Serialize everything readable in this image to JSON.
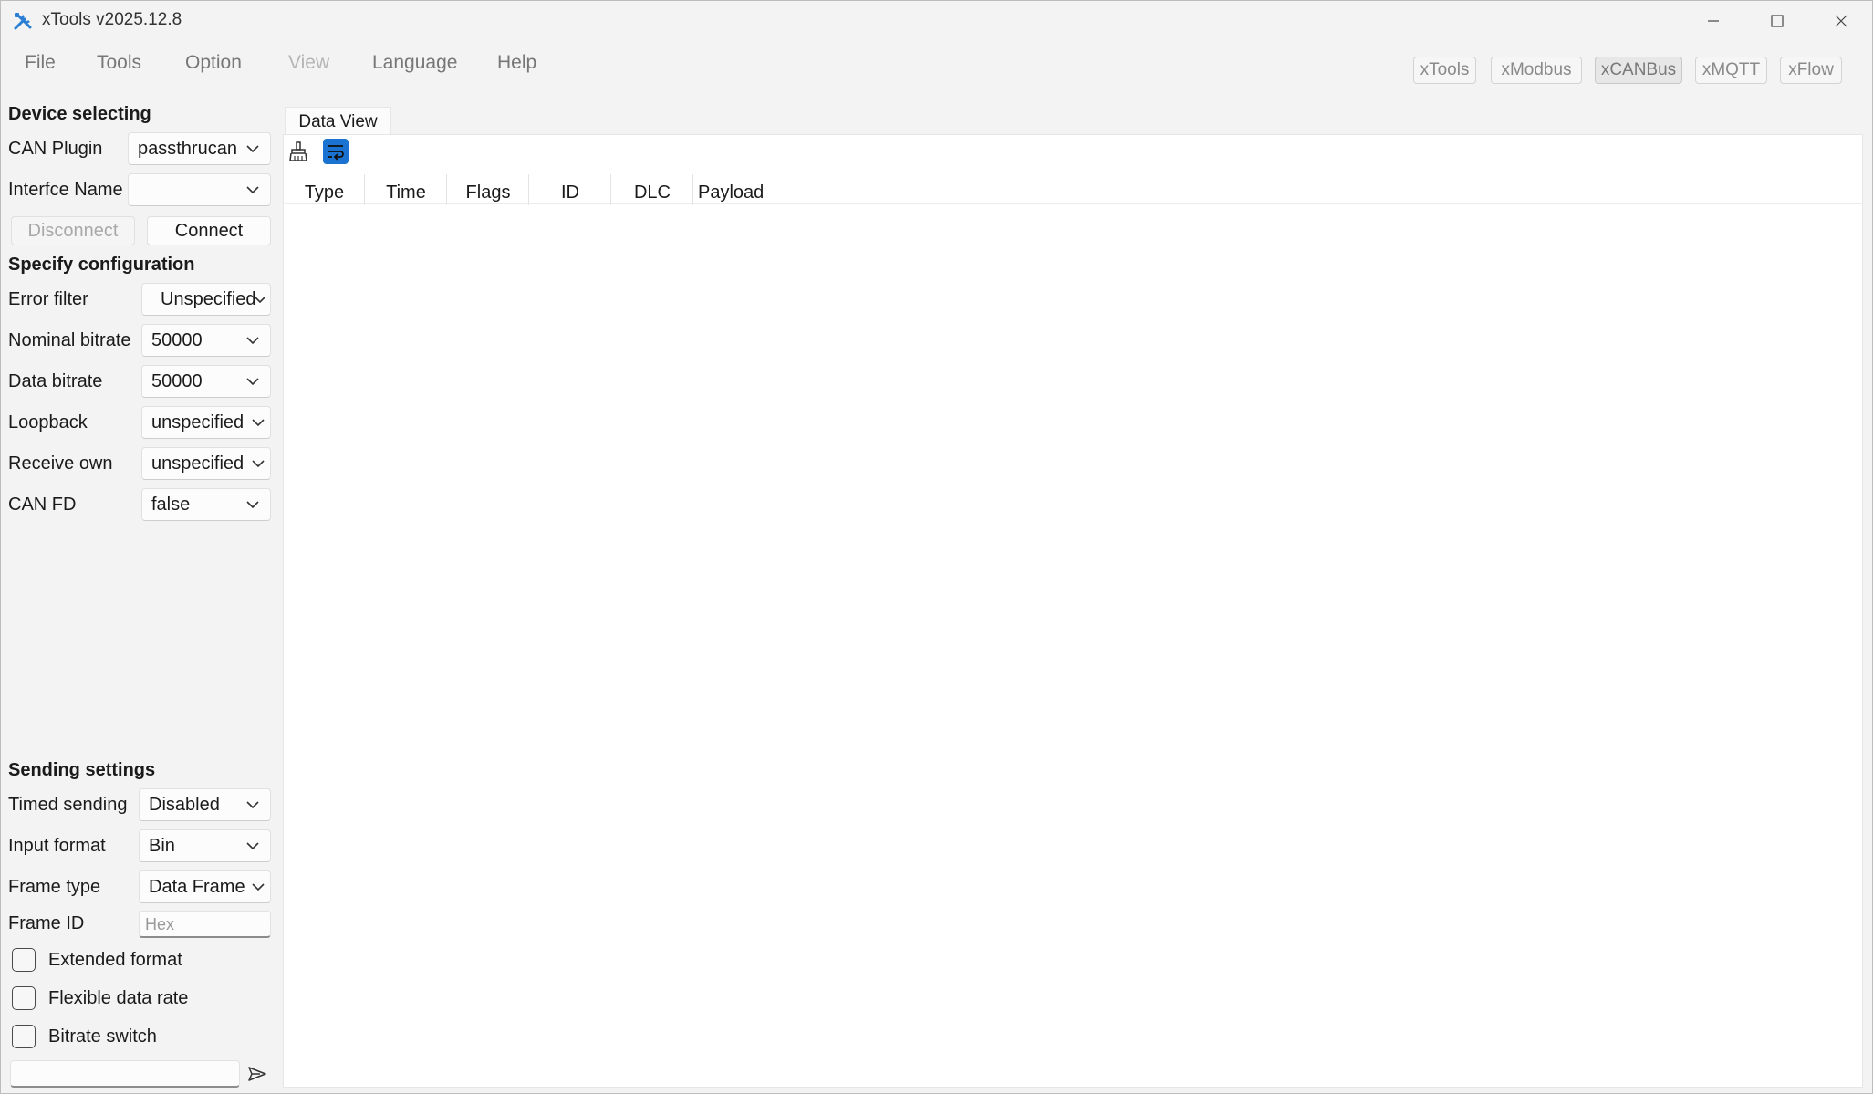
{
  "window": {
    "title": "xTools v2025.12.8"
  },
  "menu": {
    "items": [
      {
        "label": "File"
      },
      {
        "label": "Tools"
      },
      {
        "label": "Option"
      },
      {
        "label": "View"
      },
      {
        "label": "Language"
      },
      {
        "label": "Help"
      }
    ]
  },
  "modes": {
    "items": [
      {
        "label": "xTools"
      },
      {
        "label": "xModbus"
      },
      {
        "label": "xCANBus"
      },
      {
        "label": "xMQTT"
      },
      {
        "label": "xFlow"
      }
    ],
    "active": "xCANBus"
  },
  "device": {
    "title": "Device selecting",
    "plugin_label": "CAN Plugin",
    "plugin_value": "passthrucan",
    "interface_label": "Interfce Name",
    "interface_value": "",
    "disconnect_label": "Disconnect",
    "connect_label": "Connect"
  },
  "config": {
    "title": "Specify configuration",
    "error_filter_label": "Error filter",
    "error_filter_value": "Unspecified",
    "nominal_bitrate_label": "Nominal bitrate",
    "nominal_bitrate_value": "50000",
    "data_bitrate_label": "Data bitrate",
    "data_bitrate_value": "50000",
    "loopback_label": "Loopback",
    "loopback_value": "unspecified",
    "receive_own_label": "Receive own",
    "receive_own_value": "unspecified",
    "can_fd_label": "CAN FD",
    "can_fd_value": "false"
  },
  "sending": {
    "title": "Sending settings",
    "timed_label": "Timed sending",
    "timed_value": "Disabled",
    "input_format_label": "Input format",
    "input_format_value": "Bin",
    "frame_type_label": "Frame type",
    "frame_type_value": "Data Frame",
    "frame_id_label": "Frame ID",
    "frame_id_placeholder": "Hex",
    "extended_label": "Extended format",
    "flexible_label": "Flexible data rate",
    "bitrate_switch_label": "Bitrate switch",
    "payload_value": ""
  },
  "data_view": {
    "tab_label": "Data View",
    "columns": [
      "Type",
      "Time",
      "Flags",
      "ID",
      "DLC",
      "Payload"
    ],
    "rows": []
  },
  "colors": {
    "accent": "#1a73d0",
    "icon_blue": "#2a7fd4",
    "window_bg": "#f3f3f3"
  }
}
